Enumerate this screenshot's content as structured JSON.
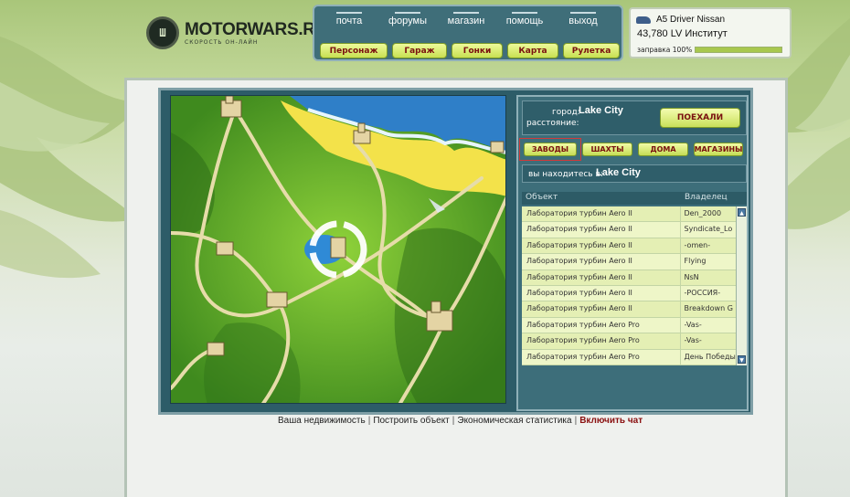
{
  "logo": {
    "title": "MOTORWARS.RU",
    "subtitle": "СКОРОСТЬ ОН-ЛАЙН",
    "badge": "Ш"
  },
  "top_links": [
    "почта",
    "форумы",
    "магазин",
    "помощь",
    "выход"
  ],
  "nav_buttons": [
    "Персонаж",
    "Гараж",
    "Гонки",
    "Карта",
    "Рулетка"
  ],
  "user": {
    "car": "A5 Driver Nissan",
    "money": "43,780 LV Институт",
    "fuel_label": "заправка 100%",
    "fuel_percent": 100
  },
  "city": {
    "city_label": "город:",
    "city_value": "Lake City",
    "distance_label": "расстояние:",
    "go_button": "ПОЕХАЛИ"
  },
  "categories": [
    "ЗАВОДЫ",
    "ШАХТЫ",
    "ДОМА",
    "МАГАЗИНЫ"
  ],
  "location": {
    "label": "вы находитесь в:",
    "value": "Lake City"
  },
  "table": {
    "headers": [
      "Объект",
      "Владелец"
    ],
    "rows": [
      [
        "Лаборатория турбин Aero II",
        "Den_2000"
      ],
      [
        "Лаборатория турбин Aero II",
        "Syndicate_Lo"
      ],
      [
        "Лаборатория турбин Aero II",
        "-omen-"
      ],
      [
        "Лаборатория турбин Aero II",
        "Flying"
      ],
      [
        "Лаборатория турбин Aero II",
        "NsN"
      ],
      [
        "Лаборатория турбин Aero II",
        "-РОССИЯ-"
      ],
      [
        "Лаборатория турбин Aero II",
        "Breakdown G"
      ],
      [
        "Лаборатория турбин Aero Pro",
        "-Vas-"
      ],
      [
        "Лаборатория турбин Aero Pro",
        "-Vas-"
      ],
      [
        "Лаборатория турбин Aero Pro",
        "День Победы"
      ]
    ]
  },
  "footer": {
    "l1": "Ваша недвижимость",
    "l2": "Построить объект",
    "l3": "Экономическая статистика",
    "l4": "Включить чат",
    "sep": "|"
  }
}
